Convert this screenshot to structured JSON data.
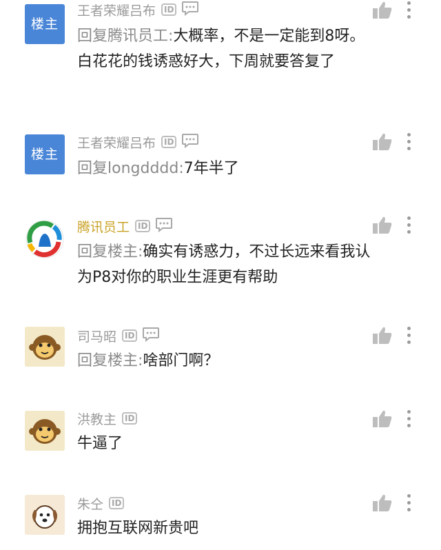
{
  "comments": [
    {
      "name": "王者荣耀吕布",
      "name_color": "gray",
      "avatar_label": "楼主",
      "has_message_icon": true,
      "reply_prefix": "回复腾讯员工:",
      "text": "大概率，不是一定能到8呀。白花花的钱诱惑好大，下周就要答复了"
    },
    {
      "name": "王者荣耀吕布",
      "name_color": "gray",
      "avatar_label": "楼主",
      "has_message_icon": true,
      "reply_prefix": "回复longdddd:",
      "text": "7年半了"
    },
    {
      "name": "腾讯员工",
      "name_color": "gold",
      "avatar_label": "",
      "has_message_icon": true,
      "reply_prefix": "回复楼主:",
      "text": "确实有诱惑力，不过长远来看我认为P8对你的职业生涯更有帮助"
    },
    {
      "name": "司马昭",
      "name_color": "gray",
      "avatar_label": "",
      "has_message_icon": true,
      "reply_prefix": "回复楼主:",
      "text": "啥部门啊？"
    },
    {
      "name": "洪教主",
      "name_color": "gray",
      "avatar_label": "",
      "has_message_icon": false,
      "reply_prefix": "",
      "text": "牛逼了"
    },
    {
      "name": "朱仝",
      "name_color": "gray",
      "avatar_label": "",
      "has_message_icon": false,
      "reply_prefix": "",
      "text": "拥抱互联网新贵吧"
    }
  ],
  "badge_text": "ID",
  "icons": {
    "like": "thumbs-up-icon",
    "more": "more-vertical-icon",
    "message": "message-bubble-icon"
  },
  "colors": {
    "host_avatar": "#4a86d8",
    "gold_name": "#c9a227",
    "gray_name": "#9b9b9b"
  }
}
